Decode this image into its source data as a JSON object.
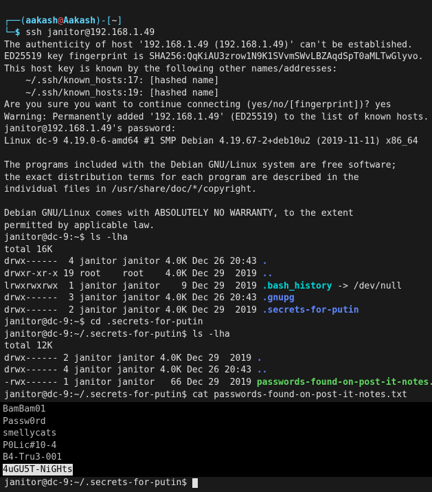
{
  "header": {
    "user": "aakash",
    "at": "@",
    "host": "Aakash",
    "path": "~"
  },
  "cmd1": "ssh janitor@192.168.1.49",
  "ssh": {
    "l1": "The authenticity of host '192.168.1.49 (192.168.1.49)' can't be established.",
    "l2": "ED25519 key fingerprint is SHA256:QqKiAU3zrow1N9K1SVvmSWvLBZAqdSpT0aMLTwGlyvo.",
    "l3": "This host key is known by the following other names/addresses:",
    "l4": "    ~/.ssh/known_hosts:17: [hashed name]",
    "l5": "    ~/.ssh/known_hosts:19: [hashed name]",
    "l6": "Are you sure you want to continue connecting (yes/no/[fingerprint])? yes",
    "l7": "Warning: Permanently added '192.168.1.49' (ED25519) to the list of known hosts.",
    "l8": "janitor@192.168.1.49's password:",
    "l9": "Linux dc-9 4.19.0-6-amd64 #1 SMP Debian 4.19.67-2+deb10u2 (2019-11-11) x86_64",
    "l10": "",
    "l11": "The programs included with the Debian GNU/Linux system are free software;",
    "l12": "the exact distribution terms for each program are described in the",
    "l13": "individual files in /usr/share/doc/*/copyright.",
    "l14": "",
    "l15": "Debian GNU/Linux comes with ABSOLUTELY NO WARRANTY, to the extent",
    "l16": "permitted by applicable law."
  },
  "p1": {
    "prompt": "janitor@dc-9:~$ ",
    "cmd": "ls -lha"
  },
  "ls1": {
    "total": "total 16K",
    "r1": {
      "perm": "drwx------  4 janitor janitor 4.0K Dec 26 20:43 ",
      "name": "."
    },
    "r2": {
      "perm": "drwxr-xr-x 19 root    root    4.0K Dec 29  2019 ",
      "name": ".."
    },
    "r3": {
      "perm": "lrwxrwxrwx  1 janitor janitor    9 Dec 29  2019 ",
      "name": ".bash_history",
      "arrow": " -> ",
      "target": "/dev/null"
    },
    "r4": {
      "perm": "drwx------  3 janitor janitor 4.0K Dec 26 20:43 ",
      "name": ".gnupg"
    },
    "r5": {
      "perm": "drwx------  2 janitor janitor 4.0K Dec 29  2019 ",
      "name": ".secrets-for-putin"
    }
  },
  "p2": {
    "prompt": "janitor@dc-9:~$ ",
    "cmd": "cd .secrets-for-putin"
  },
  "p3": {
    "prompt": "janitor@dc-9:~/.secrets-for-putin$ ",
    "cmd": "ls -lha"
  },
  "ls2": {
    "total": "total 12K",
    "r1": {
      "perm": "drwx------ 2 janitor janitor 4.0K Dec 29  2019 ",
      "name": "."
    },
    "r2": {
      "perm": "drwx------ 4 janitor janitor 4.0K Dec 26 20:43 ",
      "name": ".."
    },
    "r3": {
      "perm": "-rwx------ 1 janitor janitor   66 Dec 29  2019 ",
      "name": "passwords-found-on-post-it-notes.txt"
    }
  },
  "p4": {
    "prompt": "janitor@dc-9:~/.secrets-for-putin$ ",
    "cmd": "cat passwords-found-on-post-it-notes.txt"
  },
  "cat": {
    "l1": "BamBam01",
    "l2": "Passw0rd",
    "l3": "smellycats",
    "l4": "P0Lic#10-4",
    "l5": "B4-Tru3-001",
    "l6": "4uGU5T-NiGHts"
  },
  "p5": {
    "prompt": "janitor@dc-9:~/.secrets-for-putin$ "
  }
}
